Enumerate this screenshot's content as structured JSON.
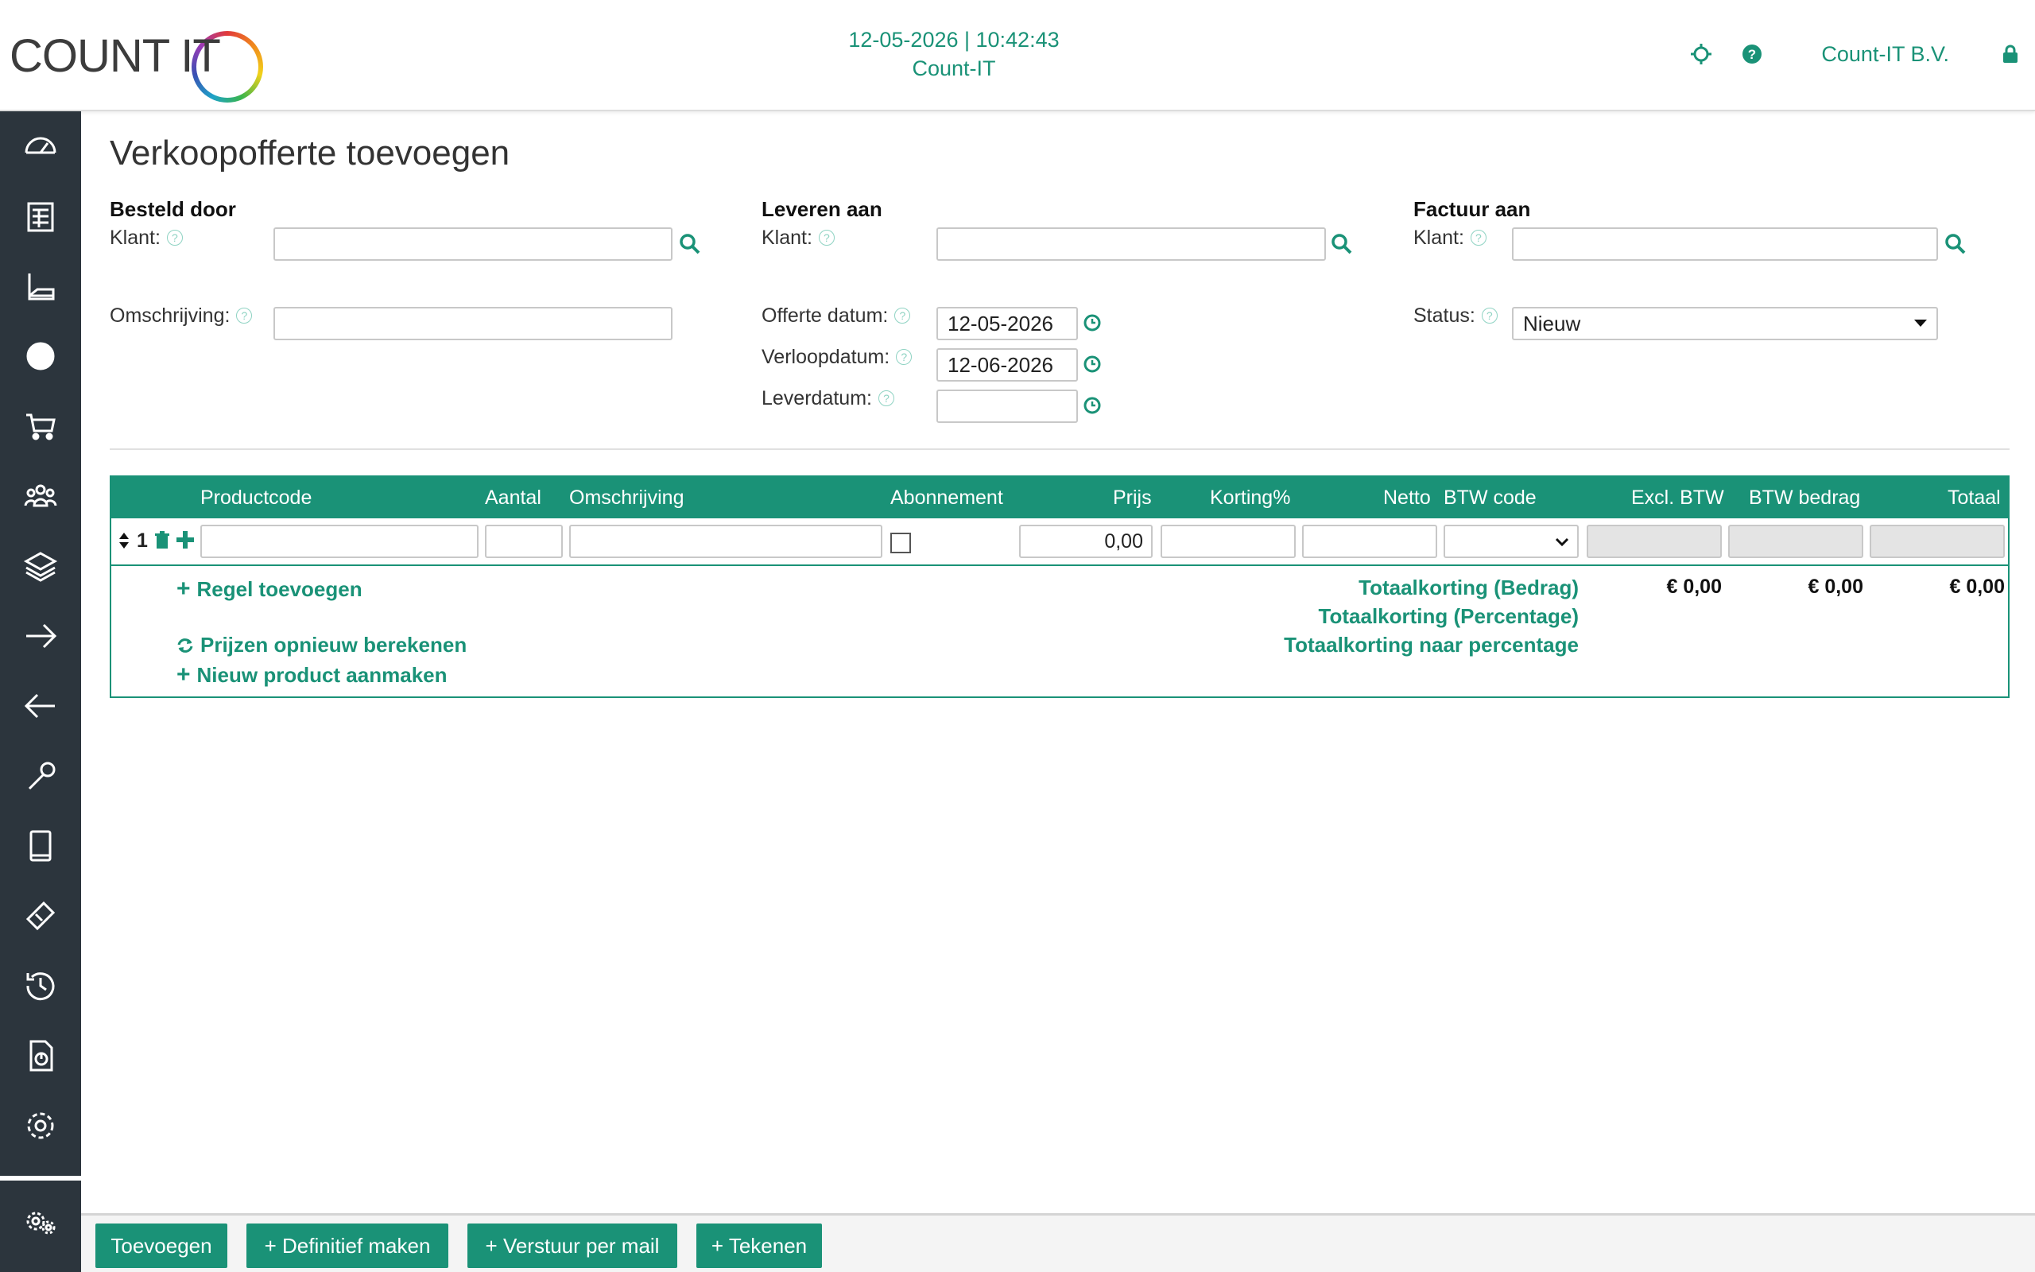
{
  "header": {
    "logo_text": "COUNT IT",
    "date_time": "12-05-2026 | 10:42:43",
    "environment": "Count-IT",
    "company": "Count-IT B.V.",
    "accent_color": "#1a9277"
  },
  "sidebar": {
    "icons": [
      "dashboard-icon",
      "accounting-icon",
      "invoice-icon",
      "globe-icon",
      "cart-icon",
      "users-icon",
      "layers-icon",
      "arrow-right-icon",
      "arrow-left-icon",
      "wrench-icon",
      "tablet-icon",
      "ticket-icon",
      "history-icon",
      "report-icon",
      "settings-icon",
      "admin-settings-icon"
    ]
  },
  "page": {
    "title": "Verkoopofferte toevoegen"
  },
  "besteld_door": {
    "title": "Besteld door",
    "klant_label": "Klant:",
    "klant_value": "",
    "omschrijving_label": "Omschrijving:",
    "omschrijving_value": ""
  },
  "leveren_aan": {
    "title": "Leveren aan",
    "klant_label": "Klant:",
    "klant_value": "",
    "offerte_datum_label": "Offerte datum:",
    "offerte_datum_value": "12-05-2026",
    "verloopdatum_label": "Verloopdatum:",
    "verloopdatum_value": "12-06-2026",
    "leverdatum_label": "Leverdatum:",
    "leverdatum_value": ""
  },
  "factuur_aan": {
    "title": "Factuur aan",
    "klant_label": "Klant:",
    "klant_value": "",
    "status_label": "Status:",
    "status_value": "Nieuw"
  },
  "table": {
    "columns": {
      "productcode": "Productcode",
      "aantal": "Aantal",
      "omschrijving": "Omschrijving",
      "abonnement": "Abonnement",
      "prijs": "Prijs",
      "korting": "Korting%",
      "netto": "Netto",
      "btw_code": "BTW code",
      "excl_btw": "Excl. BTW",
      "btw_bedrag": "BTW bedrag",
      "totaal": "Totaal"
    },
    "row": {
      "number": "1",
      "prijs": "0,00"
    },
    "add_line": "Regel toevoegen",
    "recalc": "Prijzen opnieuw berekenen",
    "new_product": "Nieuw product aanmaken",
    "total_discount_amount": "Totaalkorting (Bedrag)",
    "total_discount_percent": "Totaalkorting (Percentage)",
    "total_discount_to_percent": "Totaalkorting naar percentage",
    "sum_excl": "€ 0,00",
    "sum_btw": "€ 0,00",
    "sum_total": "€ 0,00"
  },
  "footer": {
    "add": "Toevoegen",
    "finalize": "+ Definitief maken",
    "send_mail": "+ Verstuur per mail",
    "sign": "+ Tekenen"
  }
}
